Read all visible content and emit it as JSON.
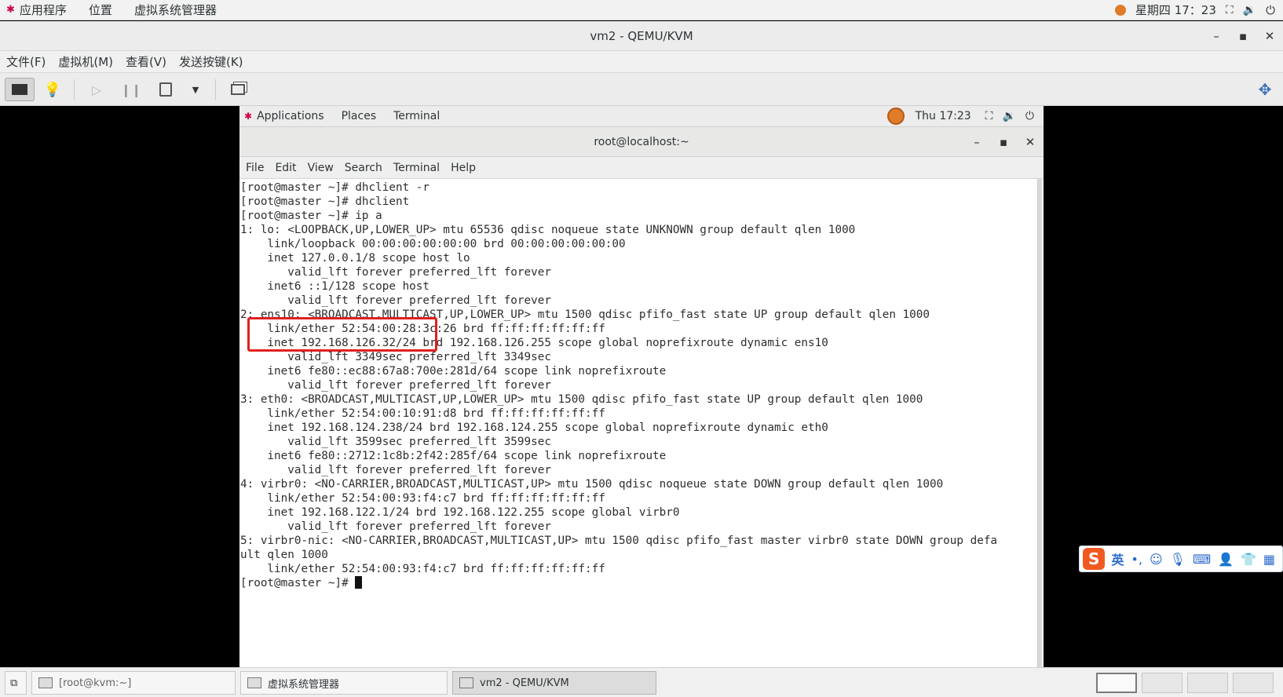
{
  "host_panel": {
    "menu": [
      "应用程序",
      "位置",
      "虚拟系统管理器"
    ],
    "clock": "星期四 17：23",
    "icons": [
      "apps-icon",
      "network-icon",
      "volume-icon",
      "power-icon"
    ]
  },
  "vm_window": {
    "title": "vm2 - QEMU/KVM",
    "controls": [
      "minimize-icon",
      "maximize-icon",
      "close-icon"
    ],
    "menu": [
      "文件(F)",
      "虚拟机(M)",
      "查看(V)",
      "发送按键(K)"
    ]
  },
  "guest_panel": {
    "menu": [
      "Applications",
      "Places",
      "Terminal"
    ],
    "clock": "Thu 17:23"
  },
  "terminal": {
    "title": "root@localhost:~",
    "menu": [
      "File",
      "Edit",
      "View",
      "Search",
      "Terminal",
      "Help"
    ],
    "lines": [
      "[root@master ~]# dhclient -r",
      "[root@master ~]# dhclient",
      "[root@master ~]# ip a",
      "1: lo: <LOOPBACK,UP,LOWER_UP> mtu 65536 qdisc noqueue state UNKNOWN group default qlen 1000",
      "    link/loopback 00:00:00:00:00:00 brd 00:00:00:00:00:00",
      "    inet 127.0.0.1/8 scope host lo",
      "       valid_lft forever preferred_lft forever",
      "    inet6 ::1/128 scope host",
      "       valid_lft forever preferred_lft forever",
      "2: ens10: <BROADCAST,MULTICAST,UP,LOWER_UP> mtu 1500 qdisc pfifo_fast state UP group default qlen 1000",
      "    link/ether 52:54:00:28:3c:26 brd ff:ff:ff:ff:ff:ff",
      "    inet 192.168.126.32/24 brd 192.168.126.255 scope global noprefixroute dynamic ens10",
      "       valid_lft 3349sec preferred_lft 3349sec",
      "    inet6 fe80::ec88:67a8:700e:281d/64 scope link noprefixroute",
      "       valid_lft forever preferred_lft forever",
      "3: eth0: <BROADCAST,MULTICAST,UP,LOWER_UP> mtu 1500 qdisc pfifo_fast state UP group default qlen 1000",
      "    link/ether 52:54:00:10:91:d8 brd ff:ff:ff:ff:ff:ff",
      "    inet 192.168.124.238/24 brd 192.168.124.255 scope global noprefixroute dynamic eth0",
      "       valid_lft 3599sec preferred_lft 3599sec",
      "    inet6 fe80::2712:1c8b:2f42:285f/64 scope link noprefixroute",
      "       valid_lft forever preferred_lft forever",
      "4: virbr0: <NO-CARRIER,BROADCAST,MULTICAST,UP> mtu 1500 qdisc noqueue state DOWN group default qlen 1000",
      "    link/ether 52:54:00:93:f4:c7 brd ff:ff:ff:ff:ff:ff",
      "    inet 192.168.122.1/24 brd 192.168.122.255 scope global virbr0",
      "       valid_lft forever preferred_lft forever",
      "5: virbr0-nic: <NO-CARRIER,BROADCAST,MULTICAST,UP> mtu 1500 qdisc pfifo_fast master virbr0 state DOWN group defa",
      "ult qlen 1000",
      "    link/ether 52:54:00:93:f4:c7 brd ff:ff:ff:ff:ff:ff",
      "[root@master ~]# "
    ]
  },
  "ime": {
    "logo": "S",
    "mode": "英",
    "punct": "•,"
  },
  "taskbar": {
    "tasks": [
      "[root@kvm:~]",
      "虚拟系统管理器",
      "vm2 - QEMU/KVM"
    ]
  }
}
